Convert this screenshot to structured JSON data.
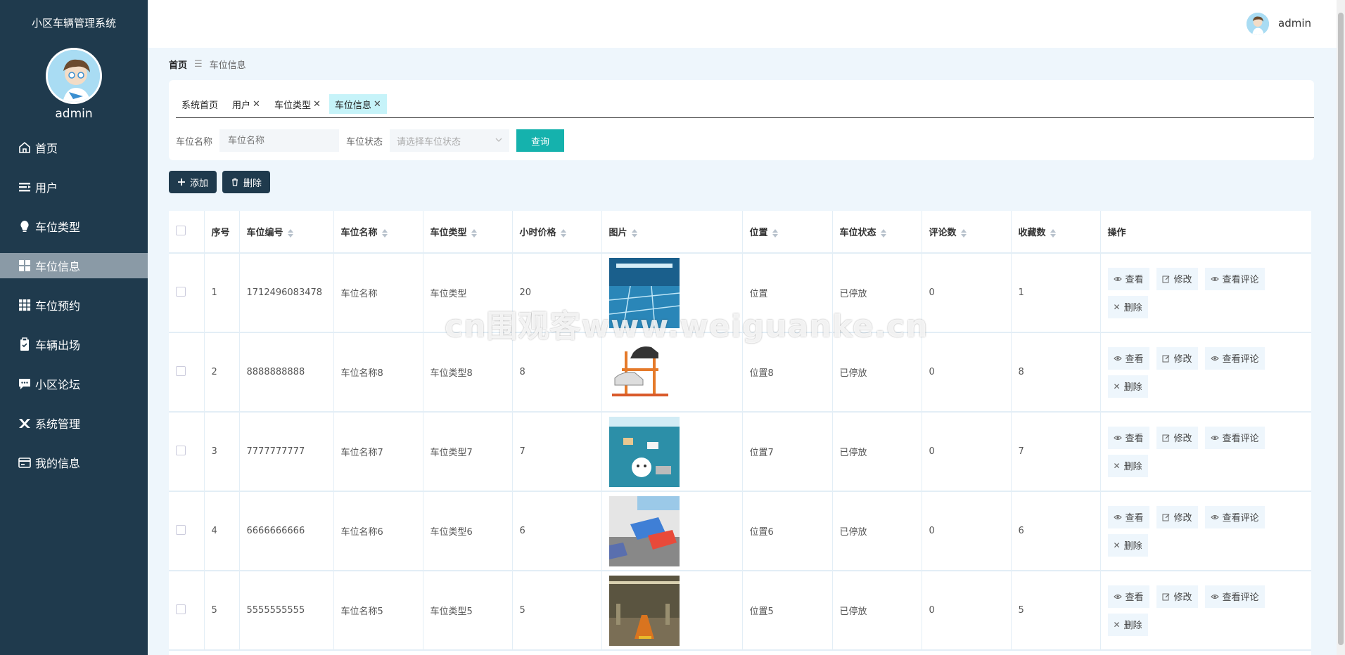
{
  "sidebar": {
    "system_title": "小区车辆管理系统",
    "username": "admin",
    "items": [
      {
        "label": "首页",
        "icon": "home-icon",
        "active": false
      },
      {
        "label": "用户",
        "icon": "users-icon",
        "active": false
      },
      {
        "label": "车位类型",
        "icon": "bulb-icon",
        "active": false
      },
      {
        "label": "车位信息",
        "icon": "grid-icon",
        "active": true
      },
      {
        "label": "车位预约",
        "icon": "apps-icon",
        "active": false
      },
      {
        "label": "车辆出场",
        "icon": "clipboard-icon",
        "active": false
      },
      {
        "label": "小区论坛",
        "icon": "chat-icon",
        "active": false
      },
      {
        "label": "系统管理",
        "icon": "tools-icon",
        "active": false
      },
      {
        "label": "我的信息",
        "icon": "card-icon",
        "active": false
      }
    ]
  },
  "header": {
    "username": "admin"
  },
  "breadcrumb": {
    "home": "首页",
    "separator": "☰",
    "current": "车位信息"
  },
  "tabs": [
    {
      "label": "系统首页",
      "closable": false,
      "active": false
    },
    {
      "label": "用户",
      "closable": true,
      "active": false
    },
    {
      "label": "车位类型",
      "closable": true,
      "active": false
    },
    {
      "label": "车位信息",
      "closable": true,
      "active": true
    }
  ],
  "search": {
    "name_label": "车位名称",
    "name_placeholder": "车位名称",
    "status_label": "车位状态",
    "status_placeholder": "请选择车位状态",
    "query_button": "查询"
  },
  "actions": {
    "add": "添加",
    "delete": "删除"
  },
  "table": {
    "headers": {
      "index": "序号",
      "code": "车位编号",
      "name": "车位名称",
      "type": "车位类型",
      "price": "小时价格",
      "image": "图片",
      "location": "位置",
      "status": "车位状态",
      "comments": "评论数",
      "favorites": "收藏数",
      "ops": "操作"
    },
    "ops": {
      "view": "查看",
      "edit": "修改",
      "view_comments": "查看评论",
      "delete": "删除"
    },
    "rows": [
      {
        "index": "1",
        "code": "1712496083478",
        "name": "车位名称",
        "type": "车位类型",
        "price": "20",
        "location": "位置",
        "status": "已停放",
        "comments": "0",
        "favorites": "1"
      },
      {
        "index": "2",
        "code": "8888888888",
        "name": "车位名称8",
        "type": "车位类型8",
        "price": "8",
        "location": "位置8",
        "status": "已停放",
        "comments": "0",
        "favorites": "8"
      },
      {
        "index": "3",
        "code": "7777777777",
        "name": "车位名称7",
        "type": "车位类型7",
        "price": "7",
        "location": "位置7",
        "status": "已停放",
        "comments": "0",
        "favorites": "7"
      },
      {
        "index": "4",
        "code": "6666666666",
        "name": "车位名称6",
        "type": "车位类型6",
        "price": "6",
        "location": "位置6",
        "status": "已停放",
        "comments": "0",
        "favorites": "6"
      },
      {
        "index": "5",
        "code": "5555555555",
        "name": "车位名称5",
        "type": "车位类型5",
        "price": "5",
        "location": "位置5",
        "status": "已停放",
        "comments": "0",
        "favorites": "5"
      }
    ]
  },
  "watermark": "cn围观客www.weiguanke.cn",
  "colors": {
    "sidebar": "#1f3a4d",
    "accent": "#15b2ad",
    "active_tab": "#c6f3f9",
    "page_bg": "#eef6fc"
  }
}
